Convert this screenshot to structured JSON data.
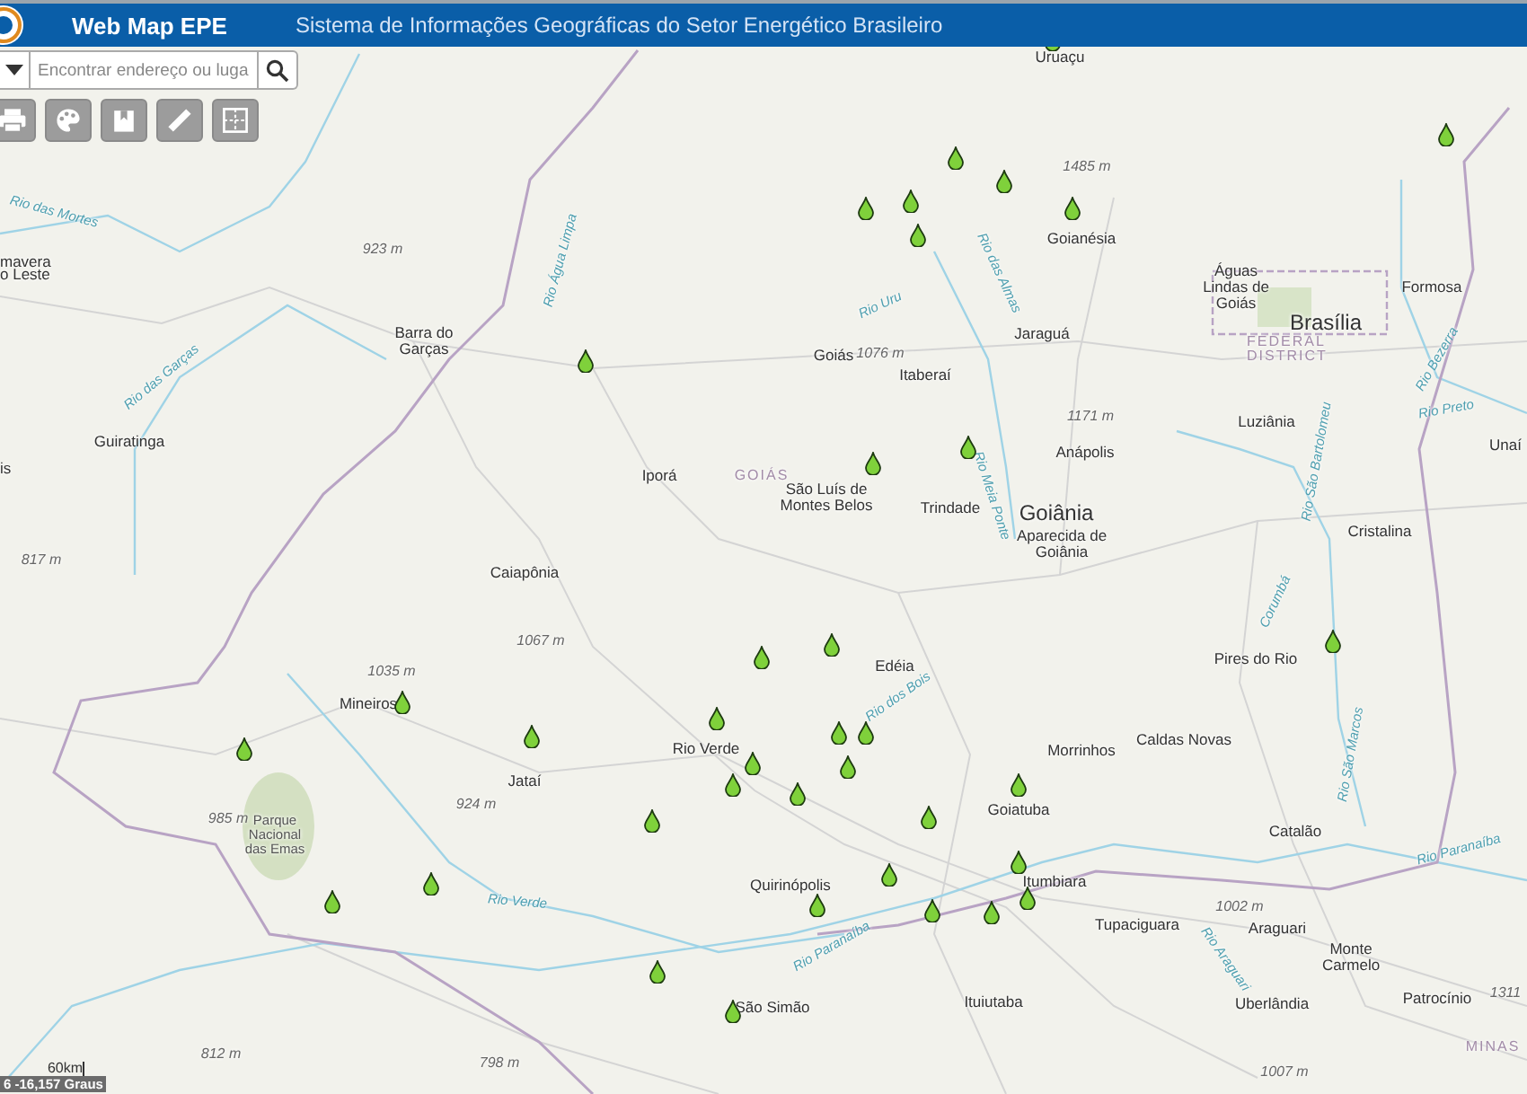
{
  "header": {
    "title": "Web Map EPE",
    "subtitle": "Sistema de Informações Geográficas do Setor Energético Brasileiro"
  },
  "search": {
    "placeholder": "Encontrar endereço ou luga"
  },
  "toolbar": [
    {
      "kind": "print"
    },
    {
      "kind": "palette"
    },
    {
      "kind": "bookmark"
    },
    {
      "kind": "ruler"
    },
    {
      "kind": "layout"
    }
  ],
  "map": {
    "places": [
      {
        "label": "Uruaçu",
        "kind": "city"
      },
      {
        "label": "mavera",
        "kind": "city"
      },
      {
        "label": "o Leste",
        "kind": "city"
      },
      {
        "label": "is",
        "kind": "city"
      },
      {
        "label": "Rio das Mortes",
        "kind": "river"
      },
      {
        "label": "923 m",
        "kind": "elevation"
      },
      {
        "label": "Barra do Garças",
        "kind": "city"
      },
      {
        "label": "Rio Água Limpa",
        "kind": "river"
      },
      {
        "label": "Rio das Garças",
        "kind": "river"
      },
      {
        "label": "Guiratinga",
        "kind": "city"
      },
      {
        "label": "Iporá",
        "kind": "city"
      },
      {
        "label": "GOIÁS",
        "kind": "region"
      },
      {
        "label": "Caiapônia",
        "kind": "city"
      },
      {
        "label": "817 m",
        "kind": "elevation"
      },
      {
        "label": "1485 m",
        "kind": "elevation"
      },
      {
        "label": "Goianésia",
        "kind": "city"
      },
      {
        "label": "Rio das Almas",
        "kind": "river"
      },
      {
        "label": "Rio Uru",
        "kind": "river"
      },
      {
        "label": "Jaraguá",
        "kind": "city"
      },
      {
        "label": "Goiás",
        "kind": "city"
      },
      {
        "label": "1076 m",
        "kind": "elevation"
      },
      {
        "label": "Itaberaí",
        "kind": "city"
      },
      {
        "label": "Águas Lindas de Goiás",
        "kind": "city"
      },
      {
        "label": "Brasília",
        "kind": "capital"
      },
      {
        "label": "FEDERAL DISTRICT",
        "kind": "region"
      },
      {
        "label": "Formosa",
        "kind": "city"
      },
      {
        "label": "Rio Bezerra",
        "kind": "river"
      },
      {
        "label": "1171 m",
        "kind": "elevation"
      },
      {
        "label": "Luziânia",
        "kind": "city"
      },
      {
        "label": "Rio Preto",
        "kind": "river"
      },
      {
        "label": "Rio São Bartolomeu",
        "kind": "river"
      },
      {
        "label": "Anápolis",
        "kind": "city"
      },
      {
        "label": "Rio Meia Ponte",
        "kind": "river"
      },
      {
        "label": "Unaí",
        "kind": "city"
      },
      {
        "label": "São Luís de Montes Belos",
        "kind": "city"
      },
      {
        "label": "Trindade",
        "kind": "city"
      },
      {
        "label": "Goiânia",
        "kind": "capital"
      },
      {
        "label": "Aparecida de Goiânia",
        "kind": "city"
      },
      {
        "label": "Cristalina",
        "kind": "city"
      },
      {
        "label": "Corumbá",
        "kind": "river"
      },
      {
        "label": "1067 m",
        "kind": "elevation"
      },
      {
        "label": "1035 m",
        "kind": "elevation"
      },
      {
        "label": "Mineiros",
        "kind": "city"
      },
      {
        "label": "Rio Verde",
        "kind": "city"
      },
      {
        "label": "Jataí",
        "kind": "city"
      },
      {
        "label": "924 m",
        "kind": "elevation"
      },
      {
        "label": "985 m",
        "kind": "elevation"
      },
      {
        "label": "Parque Nacional das Emas",
        "kind": "park"
      },
      {
        "label": "Rio Verde",
        "kind": "river"
      },
      {
        "label": "812 m",
        "kind": "elevation"
      },
      {
        "label": "798 m",
        "kind": "elevation"
      },
      {
        "label": "1007 m",
        "kind": "elevation"
      },
      {
        "label": "Edéia",
        "kind": "city"
      },
      {
        "label": "Pires do Rio",
        "kind": "city"
      },
      {
        "label": "Rio dos Bois",
        "kind": "river"
      },
      {
        "label": "Caldas Novas",
        "kind": "city"
      },
      {
        "label": "Morrinhos",
        "kind": "city"
      },
      {
        "label": "Rio São Marcos",
        "kind": "river"
      },
      {
        "label": "Goiatuba",
        "kind": "city"
      },
      {
        "label": "Catalão",
        "kind": "city"
      },
      {
        "label": "Rio Paranaíba",
        "kind": "river"
      },
      {
        "label": "Quirinópolis",
        "kind": "city"
      },
      {
        "label": "Itumbiara",
        "kind": "city"
      },
      {
        "label": "Tupaciguara",
        "kind": "city"
      },
      {
        "label": "1002 m",
        "kind": "elevation"
      },
      {
        "label": "Araguari",
        "kind": "city"
      },
      {
        "label": "Rio Araguari",
        "kind": "river"
      },
      {
        "label": "Monte Carmelo",
        "kind": "city"
      },
      {
        "label": "Rio Paranaíba",
        "kind": "river"
      },
      {
        "label": "São Simão",
        "kind": "city"
      },
      {
        "label": "Ituiutaba",
        "kind": "city"
      },
      {
        "label": "Uberlândia",
        "kind": "city"
      },
      {
        "label": "Patrocínio",
        "kind": "city"
      },
      {
        "label": "1311",
        "kind": "elevation"
      },
      {
        "label": "MINAS",
        "kind": "region"
      }
    ],
    "scale": "60km",
    "coordinates": "6 -16,157 Graus"
  }
}
